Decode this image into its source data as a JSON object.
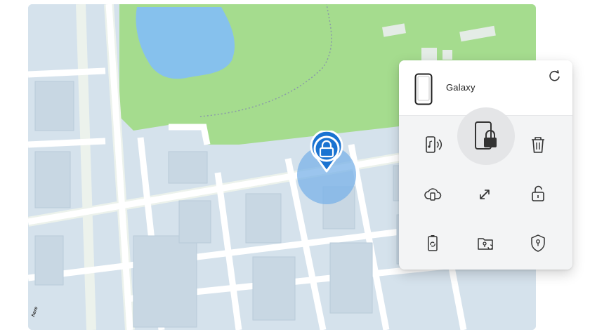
{
  "device": {
    "name": "Galaxy",
    "icon": "smartphone-icon"
  },
  "map": {
    "attribution": "here"
  },
  "actions": [
    {
      "id": "ring",
      "icon": "ring-phone-icon"
    },
    {
      "id": "lock",
      "icon": "lock-screen-icon",
      "selected": true
    },
    {
      "id": "erase",
      "icon": "trash-icon"
    },
    {
      "id": "backup",
      "icon": "cloud-backup-icon"
    },
    {
      "id": "retrieve",
      "icon": "arrows-swap-icon"
    },
    {
      "id": "unlock",
      "icon": "unlock-icon"
    },
    {
      "id": "battery",
      "icon": "battery-saver-icon"
    },
    {
      "id": "folder",
      "icon": "folder-refresh-icon"
    },
    {
      "id": "guardians",
      "icon": "shield-location-icon"
    }
  ],
  "colors": {
    "park": "#a5dc8e",
    "water": "#86c1ed",
    "blocks": "#d5e2ec",
    "roads": "#ffffff",
    "pin": "#1a73d1",
    "accuracy": "#7ab1e8"
  }
}
